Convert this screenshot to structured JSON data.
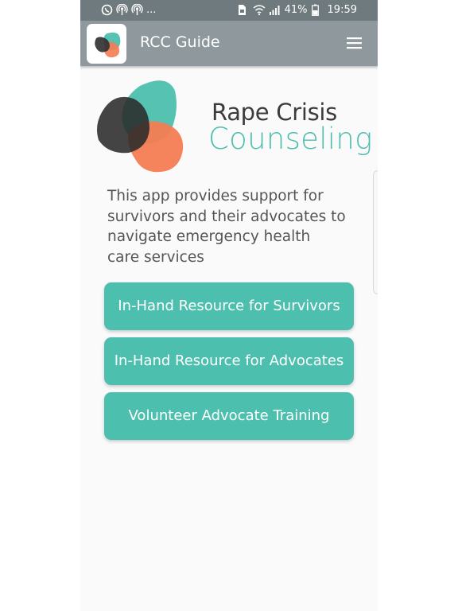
{
  "status_bar": {
    "left_more": "...",
    "battery_percent": "41%",
    "time": "19:59"
  },
  "app_bar": {
    "title": "RCC Guide"
  },
  "logo": {
    "line1": "Rape Crisis",
    "line2": "Counseling"
  },
  "description": "This app provides support for survivors and their advocates to navigate emergency health care services",
  "buttons": [
    {
      "label": "In-Hand Resource for Survivors"
    },
    {
      "label": "In-Hand Resource for Advocates"
    },
    {
      "label": "Volunteer Advocate Training"
    }
  ],
  "colors": {
    "accent": "#4dbfae",
    "dark": "#2f2f2f",
    "orange": "#f47c52",
    "app_bar": "#8f999d",
    "status_bar": "#6f7a7e"
  },
  "icons": [
    "whatsapp-icon",
    "broadcast-icon",
    "broadcast-icon",
    "sim-icon",
    "wifi-icon",
    "signal-icon",
    "battery-icon",
    "menu-icon"
  ]
}
